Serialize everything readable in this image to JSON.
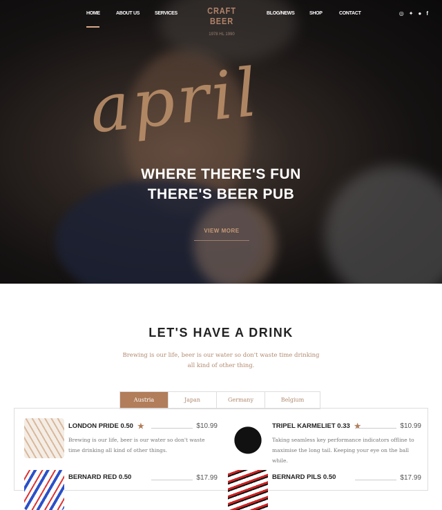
{
  "nav": {
    "left": [
      "HOME",
      "ABOUT US",
      "SERVICES"
    ],
    "right": [
      "BLOG/NEWS",
      "SHOP",
      "CONTACT"
    ],
    "active": "HOME"
  },
  "logo": {
    "title": "CRAFT BEER",
    "sub": "1978 HL 1990"
  },
  "social": [
    "instagram-icon",
    "twitter-icon",
    "pinterest-icon",
    "facebook-icon"
  ],
  "hero": {
    "script": "april",
    "headline1": "WHERE THERE'S FUN",
    "headline2": "THERE'S BEER PUB",
    "button": "VIEW MORE"
  },
  "section": {
    "title": "LET'S HAVE A DRINK",
    "subtitle": "Brewing is our life, beer is our water so don't waste time drinking all kind of other thing."
  },
  "tabs": [
    "Austria",
    "Japan",
    "Germany",
    "Belgium"
  ],
  "active_tab": "Austria",
  "accent": "#b27d5a",
  "items": [
    {
      "name": "LONDON PRIDE 0.50",
      "price": "$10.99",
      "star": true,
      "desc": "Brewing is our life, beer is our water so don't waste time drinking all kind of other things."
    },
    {
      "name": "TRIPEL KARMELIET 0.33",
      "price": "$10.99",
      "star": true,
      "desc": "Taking seamless key performance indicators offline to maximise the long tail. Keeping your eye on the ball while."
    },
    {
      "name": "BERNARD RED 0.50",
      "price": "$17.99",
      "star": false,
      "desc": ""
    },
    {
      "name": "BERNARD PILS 0.50",
      "price": "$17.99",
      "star": false,
      "desc": ""
    }
  ]
}
